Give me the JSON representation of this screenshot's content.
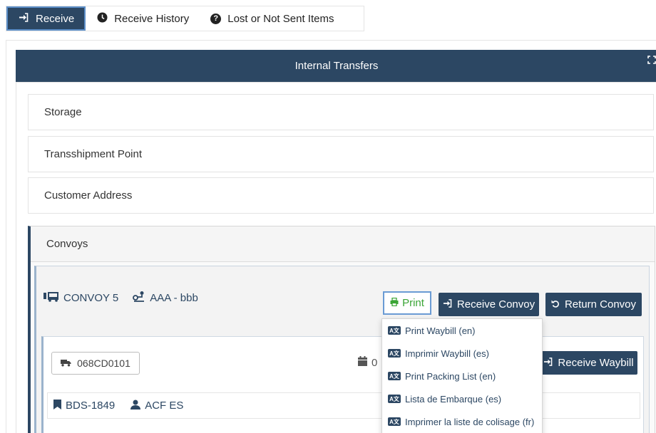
{
  "tabs": [
    {
      "label": "Receive",
      "icon": "sign-in-icon"
    },
    {
      "label": "Receive History",
      "icon": "clock-icon"
    },
    {
      "label": "Lost or Not Sent Items",
      "icon": "question-icon"
    }
  ],
  "panel": {
    "title": "Internal Transfers",
    "sections": [
      "Storage",
      "Transshipment Point",
      "Customer Address"
    ],
    "convoys_label": "Convoys"
  },
  "convoy": {
    "name": "CONVOY 5",
    "route": "AAA - bbb",
    "print_label": "Print",
    "receive_label": "Receive Convoy",
    "return_label": "Return Convoy"
  },
  "waybill": {
    "plate": "068CD0101",
    "date_partial": "0",
    "receive_label": "Receive Waybill",
    "code": "BDS-1849",
    "person": "ACF ES"
  },
  "print_menu": [
    "Print Waybill (en)",
    "Imprimir Waybill (es)",
    "Print Packing List (en)",
    "Lista de Embarque (es)",
    "Imprimer la liste de colisage (fr)"
  ],
  "colors": {
    "primary": "#2c4763",
    "accent_border": "#6a9bd4",
    "print_green": "#3aa535"
  }
}
